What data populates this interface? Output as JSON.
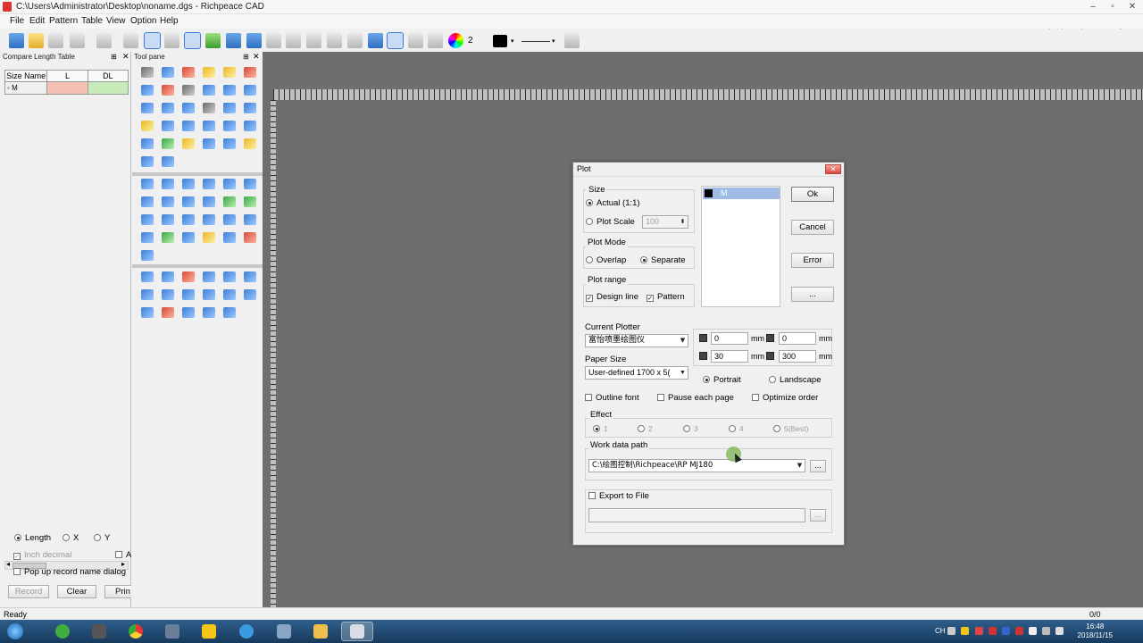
{
  "window": {
    "title": "C:\\Users\\Administrator\\Desktop\\noname.dgs - Richpeace CAD",
    "watermark": "屏幕录像专家  未注册"
  },
  "menu": [
    "File",
    "Edit",
    "Pattern",
    "Table",
    "View",
    "Option",
    "Help"
  ],
  "toolbar": {
    "line_width_value": "2"
  },
  "left_panel": {
    "title": "Compare Length Table",
    "columns": [
      "Size Name",
      "L",
      "DL"
    ],
    "row_size": "M",
    "options": {
      "length": "Length",
      "x": "X",
      "y": "Y",
      "inch_decimal": "Inch decimal",
      "popup": "Pop up record name dialog",
      "partial_a": "A"
    },
    "buttons": {
      "record": "Record",
      "clear": "Clear",
      "print": "Prin"
    }
  },
  "tool_pane": {
    "title": "Tool pane"
  },
  "dialog": {
    "title": "Plot",
    "size_group": "Size",
    "actual": "Actual (1:1)",
    "plot_scale": "Plot Scale",
    "plot_scale_value": "100",
    "plot_mode_group": "Plot Mode",
    "overlap": "Overlap",
    "separate": "Separate",
    "plot_range_group": "Plot range",
    "design_line": "Design line",
    "pattern": "Pattern",
    "list_item": "M",
    "buttons": {
      "ok": "Ok",
      "cancel": "Cancel",
      "error": "Error",
      "more": "..."
    },
    "current_plotter_label": "Current Plotter",
    "current_plotter_value": "富怡喷墨绘图仪",
    "paper_size_label": "Paper Size",
    "paper_size_value": "User-defined 1700 x 5(",
    "margins": {
      "top": "0",
      "right_top": "0",
      "left": "30",
      "right": "300",
      "unit": "mm"
    },
    "portrait": "Portrait",
    "landscape": "Landscape",
    "outline_font": "Outline font",
    "pause_each_page": "Pause each page",
    "optimize_order": "Optimize order",
    "effect_group": "Effect",
    "effect_options": [
      "1",
      "2",
      "3",
      "4",
      "5(Best)"
    ],
    "work_data_path_group": "Work data path",
    "work_data_path_value": "C:\\绘图控制\\Richpeace\\RP MJ180",
    "browse": "...",
    "export_to_file": "Export to File",
    "export_browse": "..."
  },
  "status": {
    "left": "Ready",
    "right": "0/0"
  },
  "taskbar": {
    "time": "16:48",
    "date": "2018/11/15",
    "ime": "CH"
  }
}
